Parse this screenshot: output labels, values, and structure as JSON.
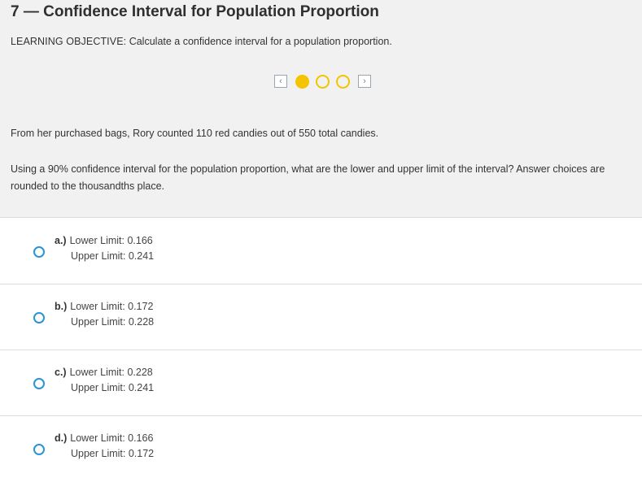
{
  "title": "7 — Confidence Interval for Population Proportion",
  "objective": {
    "label": "LEARNING OBJECTIVE:",
    "text": "Calculate a confidence interval for a population proportion."
  },
  "pager": {
    "prev_icon": "chevron-left-icon",
    "next_icon": "chevron-right-icon",
    "prev_glyph": "‹",
    "next_glyph": "›",
    "accent": "#f5c400",
    "current": 1,
    "total": 3
  },
  "problem": "From her purchased bags, Rory counted 110 red candies out of 550 total candies.",
  "question": "Using a 90% confidence interval for the population proportion, what are the lower and upper limit of the interval? Answer choices are rounded to the thousandths place.",
  "choices": [
    {
      "letter": "a.)",
      "lower": "Lower Limit: 0.166",
      "upper": "Upper Limit: 0.241"
    },
    {
      "letter": "b.)",
      "lower": "Lower Limit: 0.172",
      "upper": "Upper Limit: 0.228"
    },
    {
      "letter": "c.)",
      "lower": "Lower Limit: 0.228",
      "upper": "Upper Limit: 0.241"
    },
    {
      "letter": "d.)",
      "lower": "Lower Limit: 0.166",
      "upper": "Upper Limit: 0.172"
    }
  ],
  "colors": {
    "radio": "#2a94d6",
    "panel_bg": "#f1f1f1"
  }
}
